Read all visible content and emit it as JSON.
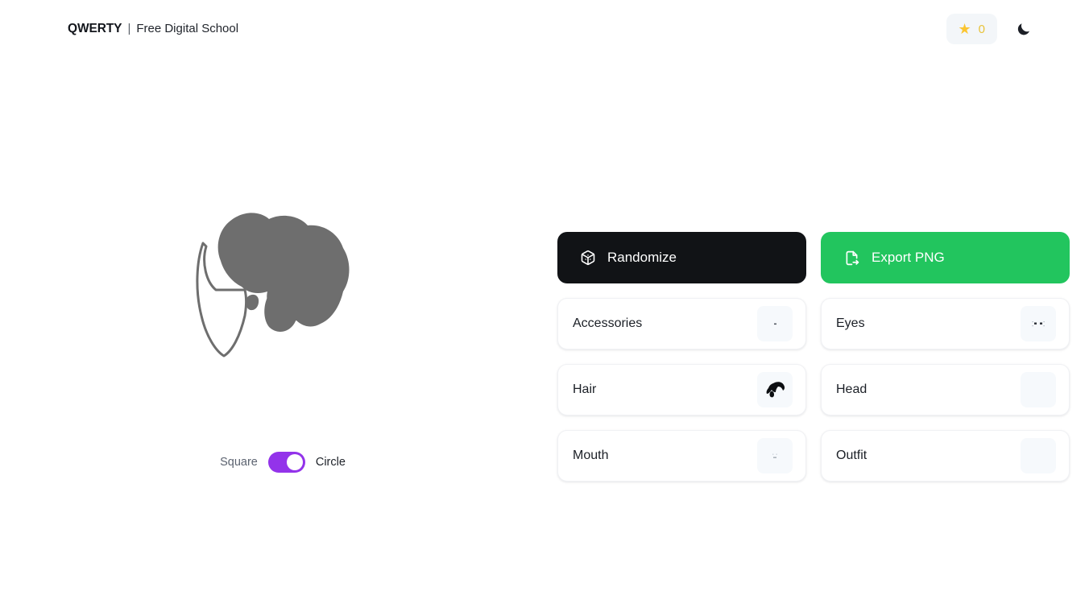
{
  "header": {
    "brand_name": "QWERTY",
    "brand_divider": "|",
    "brand_tagline": "Free Digital School",
    "star_icon": "star-icon",
    "star_count": "0",
    "theme_icon": "moon-icon",
    "accent_star_color": "#fbc531"
  },
  "avatar": {
    "name": "avatar-preview",
    "shape": "circle",
    "outline_color": "#6e6e6e",
    "hair_color": "#6e6e6e",
    "face_fill": "#ffffff"
  },
  "shape_toggle": {
    "left_label": "Square",
    "right_label": "Circle",
    "selected": "Circle",
    "accent_color": "#9333ea"
  },
  "actions": [
    {
      "label": "Randomize",
      "icon": "dice-icon",
      "name": "randomize-button",
      "bg": "#111316",
      "fg": "#ffffff"
    },
    {
      "label": "Export PNG",
      "icon": "file-export-icon",
      "name": "export-png-button",
      "bg": "#22c55e",
      "fg": "#ffffff"
    }
  ],
  "features": [
    {
      "label": "Accessories",
      "name": "feature-card-accessories",
      "thumb": "accessories-thumb"
    },
    {
      "label": "Eyes",
      "name": "feature-card-eyes",
      "thumb": "eyes-thumb"
    },
    {
      "label": "Hair",
      "name": "feature-card-hair",
      "thumb": "hair-thumb"
    },
    {
      "label": "Head",
      "name": "feature-card-head",
      "thumb": "head-thumb"
    },
    {
      "label": "Mouth",
      "name": "feature-card-mouth",
      "thumb": "mouth-thumb"
    },
    {
      "label": "Outfit",
      "name": "feature-card-outfit",
      "thumb": "outfit-thumb"
    }
  ]
}
